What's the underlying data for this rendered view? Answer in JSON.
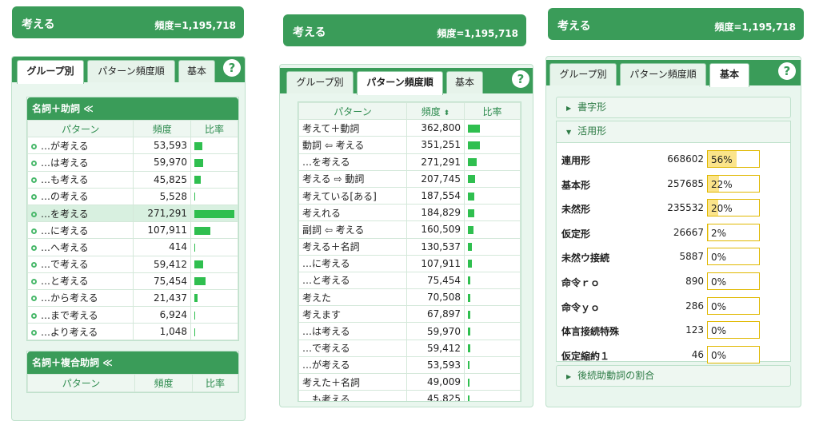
{
  "word": "考える",
  "freq": "頻度=1,195,718",
  "tabs": [
    "グループ別",
    "パターン頻度順",
    "基本"
  ],
  "help": "?",
  "cols": {
    "pattern": "パターン",
    "freq": "頻度",
    "ratio": "比率"
  },
  "p1": {
    "group1": "名詞＋助詞",
    "collapse": "≪",
    "group2": "名詞＋複合助詞",
    "rows": [
      {
        "pattern": "…が考える",
        "freq": "53,593",
        "ratio": 0.198
      },
      {
        "pattern": "…は考える",
        "freq": "59,970",
        "ratio": 0.221
      },
      {
        "pattern": "…も考える",
        "freq": "45,825",
        "ratio": 0.169
      },
      {
        "pattern": "…の考える",
        "freq": "5,528",
        "ratio": 0.02
      },
      {
        "pattern": "…を考える",
        "freq": "271,291",
        "ratio": 1.0
      },
      {
        "pattern": "…に考える",
        "freq": "107,911",
        "ratio": 0.398
      },
      {
        "pattern": "…へ考える",
        "freq": "414",
        "ratio": 0.0
      },
      {
        "pattern": "…で考える",
        "freq": "59,412",
        "ratio": 0.219
      },
      {
        "pattern": "…と考える",
        "freq": "75,454",
        "ratio": 0.278
      },
      {
        "pattern": "…から考える",
        "freq": "21,437",
        "ratio": 0.079
      },
      {
        "pattern": "…まで考える",
        "freq": "6,924",
        "ratio": 0.026
      },
      {
        "pattern": "…より考える",
        "freq": "1,048",
        "ratio": 0.004
      }
    ]
  },
  "p2": {
    "sort": "⬍",
    "rows": [
      {
        "pattern": "考えて＋動詞",
        "freq": "362,800",
        "ratio": 0.303
      },
      {
        "pattern": "動詞 ⇦ 考える",
        "freq": "351,251",
        "ratio": 0.294
      },
      {
        "pattern": "…を考える",
        "freq": "271,291",
        "ratio": 0.227
      },
      {
        "pattern": "考える ⇨ 動詞",
        "freq": "207,745",
        "ratio": 0.174
      },
      {
        "pattern": "考えている[ある]",
        "freq": "187,554",
        "ratio": 0.157
      },
      {
        "pattern": "考えれる",
        "freq": "184,829",
        "ratio": 0.155
      },
      {
        "pattern": "副詞 ⇦ 考える",
        "freq": "160,509",
        "ratio": 0.134
      },
      {
        "pattern": "考える＋名詞",
        "freq": "130,537",
        "ratio": 0.109
      },
      {
        "pattern": "…に考える",
        "freq": "107,911",
        "ratio": 0.09
      },
      {
        "pattern": "…と考える",
        "freq": "75,454",
        "ratio": 0.063
      },
      {
        "pattern": "考えた",
        "freq": "70,508",
        "ratio": 0.059
      },
      {
        "pattern": "考えます",
        "freq": "67,897",
        "ratio": 0.057
      },
      {
        "pattern": "…は考える",
        "freq": "59,970",
        "ratio": 0.05
      },
      {
        "pattern": "…で考える",
        "freq": "59,412",
        "ratio": 0.05
      },
      {
        "pattern": "…が考える",
        "freq": "53,593",
        "ratio": 0.045
      },
      {
        "pattern": "考えた＋名詞",
        "freq": "49,009",
        "ratio": 0.041
      },
      {
        "pattern": "…も考える",
        "freq": "45,825",
        "ratio": 0.038
      }
    ]
  },
  "p3": {
    "sec1": "書字形",
    "sec2": "活用形",
    "sec3": "後続助動詞の割合",
    "rows": [
      {
        "label": "連用形",
        "count": "668602",
        "pct": "56%",
        "ratio": 0.56
      },
      {
        "label": "基本形",
        "count": "257685",
        "pct": "22%",
        "ratio": 0.22
      },
      {
        "label": "未然形",
        "count": "235532",
        "pct": "20%",
        "ratio": 0.2
      },
      {
        "label": "仮定形",
        "count": "26667",
        "pct": "2%",
        "ratio": 0.02
      },
      {
        "label": "未然ウ接続",
        "count": "5887",
        "pct": "0%",
        "ratio": 0.0
      },
      {
        "label": "命令ｒｏ",
        "count": "890",
        "pct": "0%",
        "ratio": 0.0
      },
      {
        "label": "命令ｙｏ",
        "count": "286",
        "pct": "0%",
        "ratio": 0.0
      },
      {
        "label": "体言接続特殊",
        "count": "123",
        "pct": "0%",
        "ratio": 0.0
      },
      {
        "label": "仮定縮約１",
        "count": "46",
        "pct": "0%",
        "ratio": 0.0
      }
    ]
  },
  "colors": {
    "green": "#3a9c59",
    "bar": "#2fbf4f",
    "pctfill": "#fbe48a"
  }
}
